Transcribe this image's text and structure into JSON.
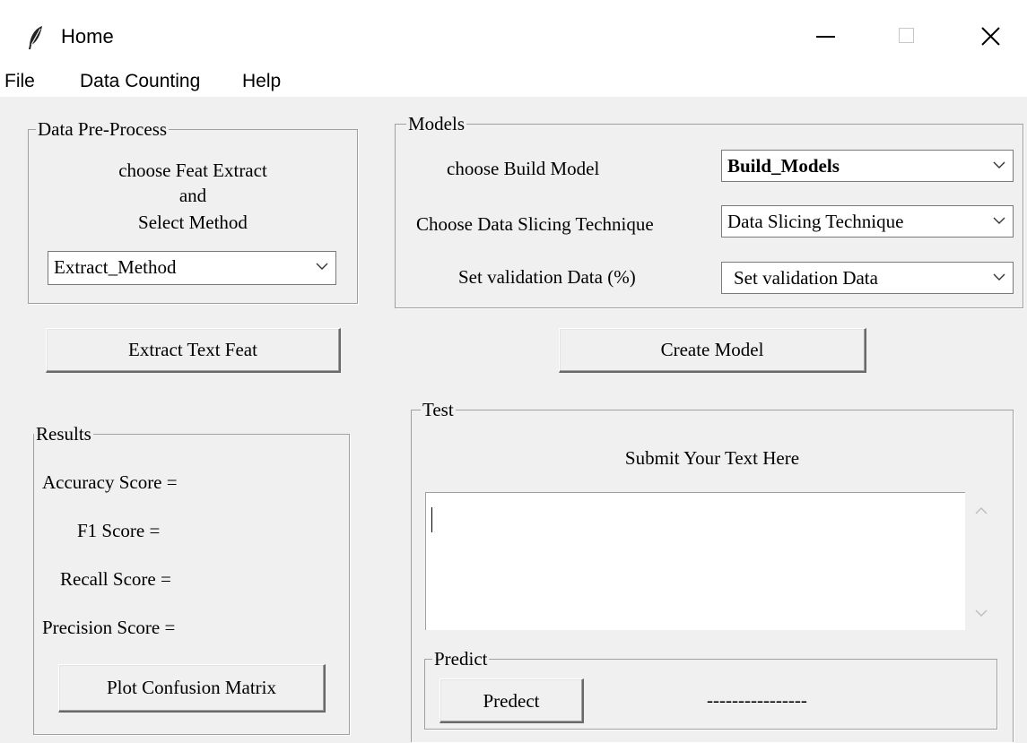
{
  "window": {
    "title": "Home",
    "app_icon": "feather-icon"
  },
  "menu": [
    "File",
    "Data Counting",
    "Help"
  ],
  "preprocess": {
    "legend": "Data Pre-Process",
    "line1": "choose Feat Extract",
    "line2": "and",
    "line3": "Select Method",
    "method_value": "Extract_Method"
  },
  "extract_button": "Extract Text Feat",
  "models": {
    "legend": "Models",
    "build_label": "choose Build Model",
    "build_value": "Build_Models",
    "slicing_label": "Choose Data Slicing Technique",
    "slicing_value": "Data Slicing Technique",
    "validation_label": "Set validation Data (%)",
    "validation_value": "Set validation Data"
  },
  "create_button": "Create Model",
  "results": {
    "legend": "Results",
    "accuracy": "Accuracy Score =",
    "f1": "F1 Score =",
    "recall": "Recall Score =",
    "precision": "Precision Score =",
    "plot_button": "Plot Confusion Matrix"
  },
  "test": {
    "legend": "Test",
    "prompt": "Submit Your Text Here",
    "text_value": ""
  },
  "predict": {
    "legend": "Predict",
    "button": "Predect",
    "output": "----------------"
  }
}
